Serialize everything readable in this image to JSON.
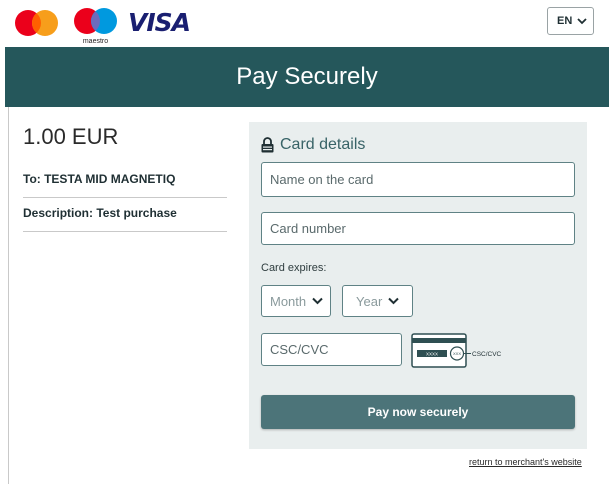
{
  "brand_logos": {
    "mastercard": "mastercard-logo",
    "maestro": {
      "icon": "maestro-logo",
      "text": "maestro"
    },
    "visa": "VISA"
  },
  "language": {
    "selected": "EN"
  },
  "header": {
    "title": "Pay Securely"
  },
  "summary": {
    "amount": "1.00 EUR",
    "to": "To: TESTA MID MAGNETIQ",
    "description": "Description: Test purchase"
  },
  "card_form": {
    "title": "Card details",
    "name_placeholder": "Name on the card",
    "number_placeholder": "Card number",
    "expires_label": "Card expires:",
    "month_selected": "Month",
    "year_selected": "Year",
    "csc_placeholder": "CSC/CVC",
    "csc_hint": "CSC/CVC",
    "card_digits": "XXXX",
    "csc_digits": "XXX",
    "pay_button": "Pay now securely"
  },
  "footer": {
    "return_link": "return to merchant's website"
  },
  "colors": {
    "header_bg": "#25575b",
    "panel_bg": "#e9eeee",
    "button_bg": "#4c7479",
    "field_border": "#5f8285",
    "visa_blue": "#1a1f71",
    "mastercard_red": "#eb001b",
    "mastercard_orange": "#f79e1b",
    "maestro_blue": "#0099df"
  }
}
